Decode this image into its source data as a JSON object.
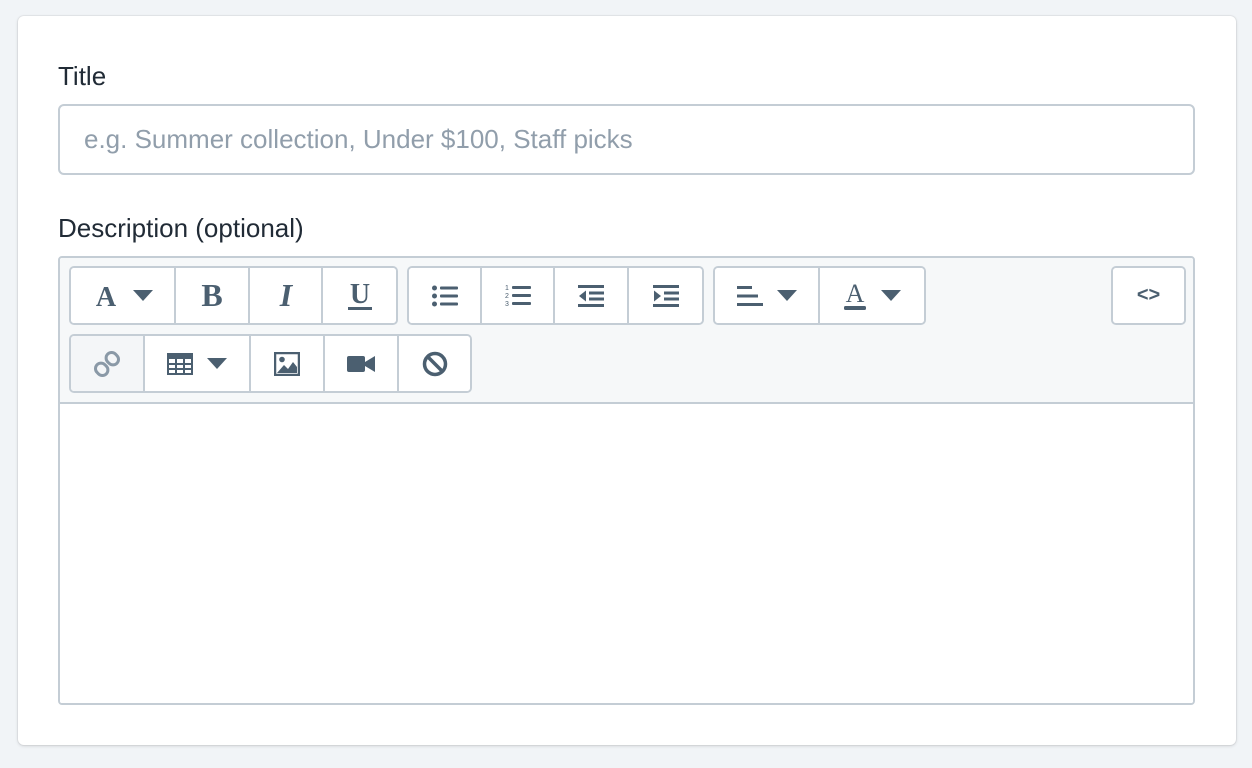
{
  "form": {
    "title_label": "Title",
    "title_value": "",
    "title_placeholder": "e.g. Summer collection, Under $100, Staff picks",
    "description_label": "Description (optional)"
  },
  "toolbar": {
    "row1_groups": [
      [
        "font-style-dropdown",
        "bold",
        "italic",
        "underline"
      ],
      [
        "unordered-list",
        "ordered-list",
        "outdent",
        "indent"
      ],
      [
        "align-dropdown",
        "text-color-dropdown"
      ],
      [
        "code-view"
      ]
    ],
    "row2_groups": [
      [
        "link",
        "table-dropdown",
        "image",
        "video",
        "clear-formatting"
      ]
    ],
    "code_view_label": "<>",
    "icon_color": "#4b5f70",
    "active_button": "link"
  },
  "editor": {
    "content": ""
  }
}
